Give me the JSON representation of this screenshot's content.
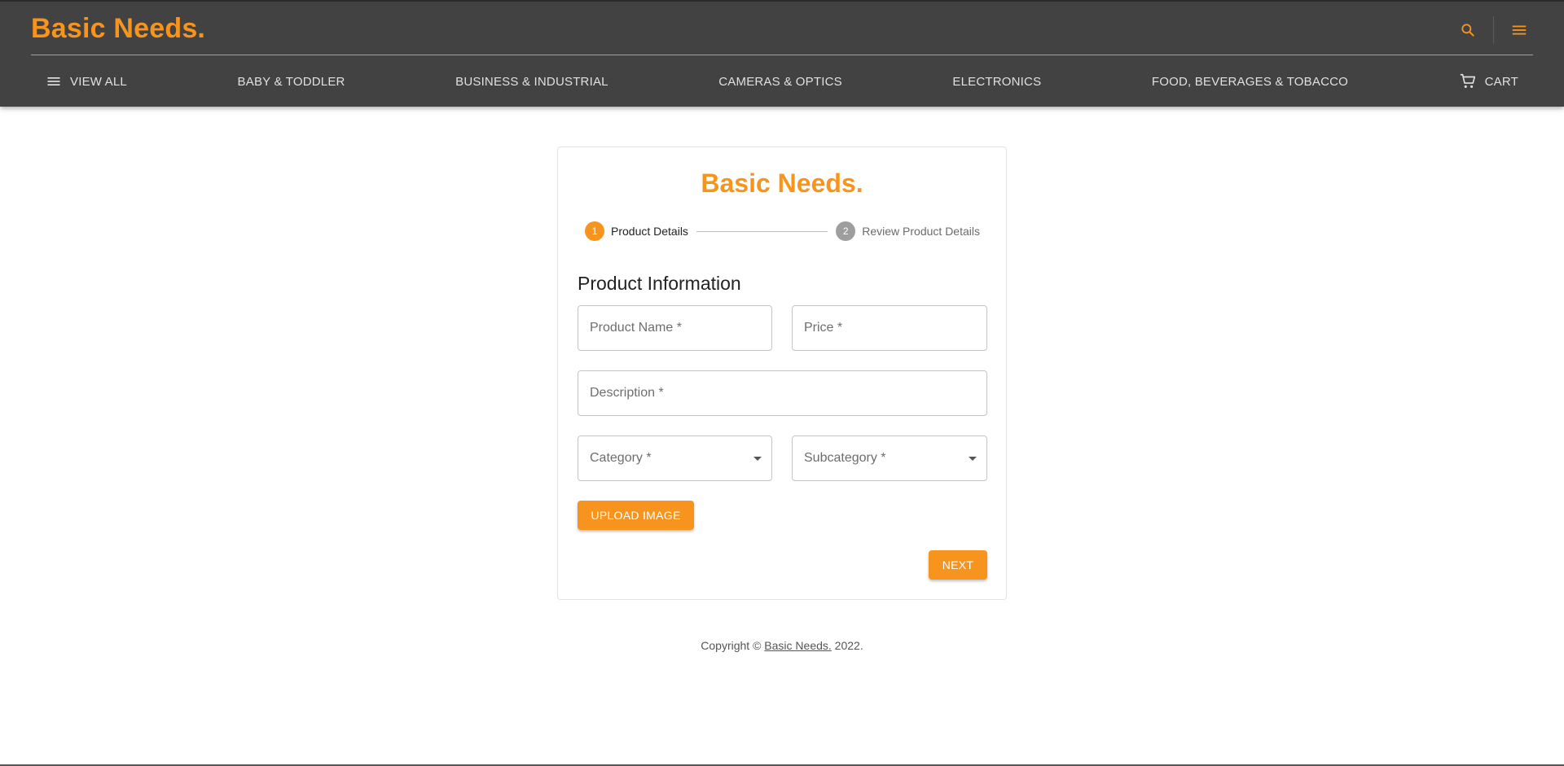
{
  "header": {
    "brand": "Basic Needs.",
    "nav": [
      {
        "label": "VIEW ALL"
      },
      {
        "label": "BABY & TODDLER"
      },
      {
        "label": "BUSINESS & INDUSTRIAL"
      },
      {
        "label": "CAMERAS & OPTICS"
      },
      {
        "label": "ELECTRONICS"
      },
      {
        "label": "FOOD, BEVERAGES & TOBACCO"
      }
    ],
    "cart_label": "CART",
    "icons": [
      "search-icon",
      "menu-icon",
      "cart-icon"
    ]
  },
  "form": {
    "brand": "Basic Needs.",
    "steps": [
      {
        "number": "1",
        "label": "Product Details",
        "active": true
      },
      {
        "number": "2",
        "label": "Review Product Details",
        "active": false
      }
    ],
    "title": "Product Information",
    "fields": {
      "product_name": "Product Name *",
      "price": "Price *",
      "description": "Description *",
      "category": "Category *",
      "subcategory": "Subcategory *"
    },
    "upload_label": "UPLOAD IMAGE",
    "next_label": "NEXT"
  },
  "footer": {
    "prefix": "Copyright © ",
    "link": "Basic Needs.",
    "suffix": " 2022."
  },
  "colors": {
    "accent": "#f7941d",
    "header_bg": "#424242"
  }
}
